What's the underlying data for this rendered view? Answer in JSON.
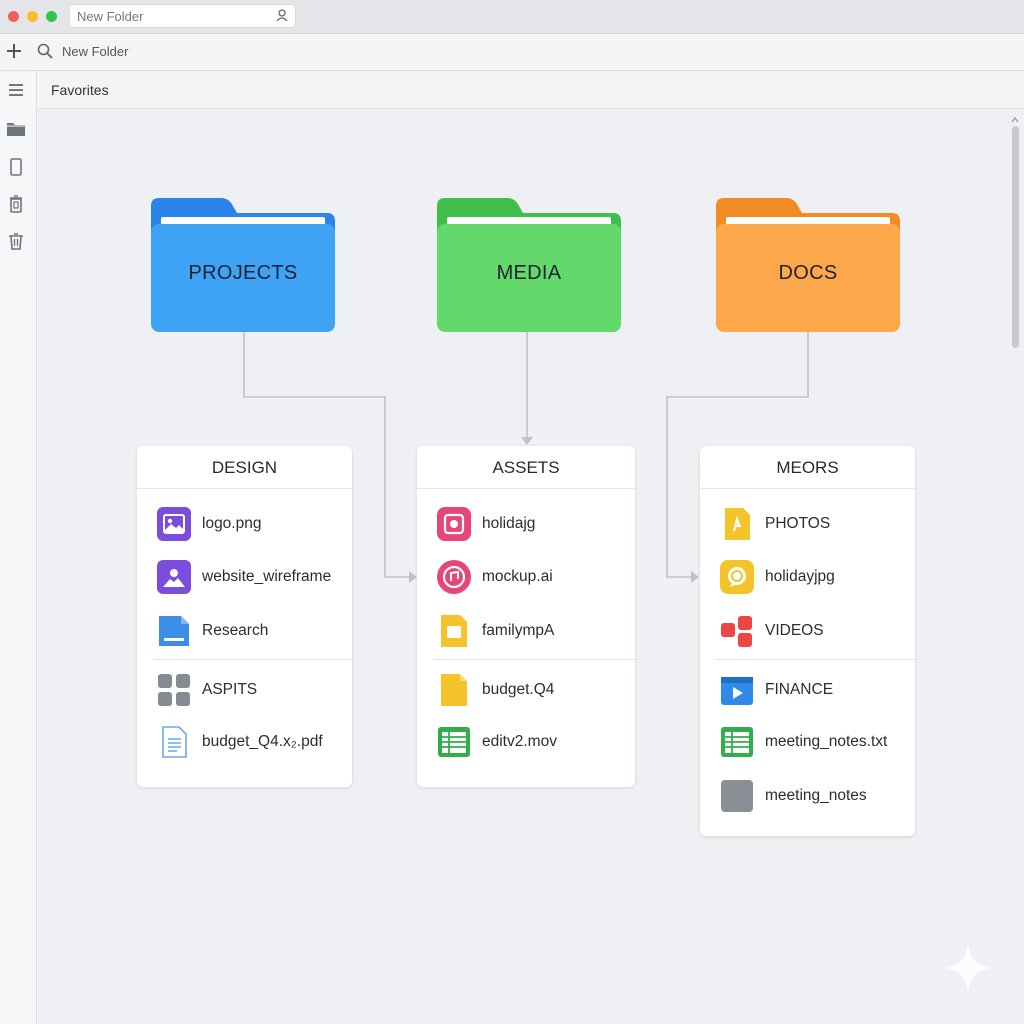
{
  "window": {
    "title_field": "New Folder"
  },
  "toolbar": {
    "search_label": "New Folder"
  },
  "breadcrumb": {
    "label": "Favorites"
  },
  "folders": [
    {
      "label": "PROJECTS",
      "color": "#3ea2f5",
      "tab_color": "#2b84ea"
    },
    {
      "label": "MEDIA",
      "color": "#62d96a",
      "tab_color": "#3fbf4a"
    },
    {
      "label": "DOCS",
      "color": "#fca84a",
      "tab_color": "#f28c22"
    }
  ],
  "cards": [
    {
      "title": "DESIGN",
      "items": [
        {
          "label": "logo.png",
          "icon": "image-icon"
        },
        {
          "label": "website_wireframe",
          "icon": "image-icon"
        },
        {
          "label": "Research",
          "icon": "document-icon"
        },
        {
          "label": "ASPITS",
          "icon": "grid-icon"
        },
        {
          "label": "budget_Q4.x₂.pdf",
          "icon": "text-file-icon"
        }
      ]
    },
    {
      "title": "ASSETS",
      "items": [
        {
          "label": "holidajg",
          "icon": "photo-icon"
        },
        {
          "label": "mockup.ai",
          "icon": "music-icon"
        },
        {
          "label": "familympA",
          "icon": "slides-icon"
        },
        {
          "label": "budget.Q4",
          "icon": "slides-icon"
        },
        {
          "label": "editv2.mov",
          "icon": "sheet-icon"
        }
      ]
    },
    {
      "title": "MEORS",
      "items": [
        {
          "label": "PHOTOS",
          "icon": "file-icon"
        },
        {
          "label": "holidayjpg",
          "icon": "chat-icon"
        },
        {
          "label": "VIDEOS",
          "icon": "shapes-icon"
        },
        {
          "label": "FINANCE",
          "icon": "video-icon"
        },
        {
          "label": "meeting_notes.txt",
          "icon": "sheet-icon"
        },
        {
          "label": "meeting_notes",
          "icon": "blank-file-icon"
        }
      ]
    }
  ]
}
